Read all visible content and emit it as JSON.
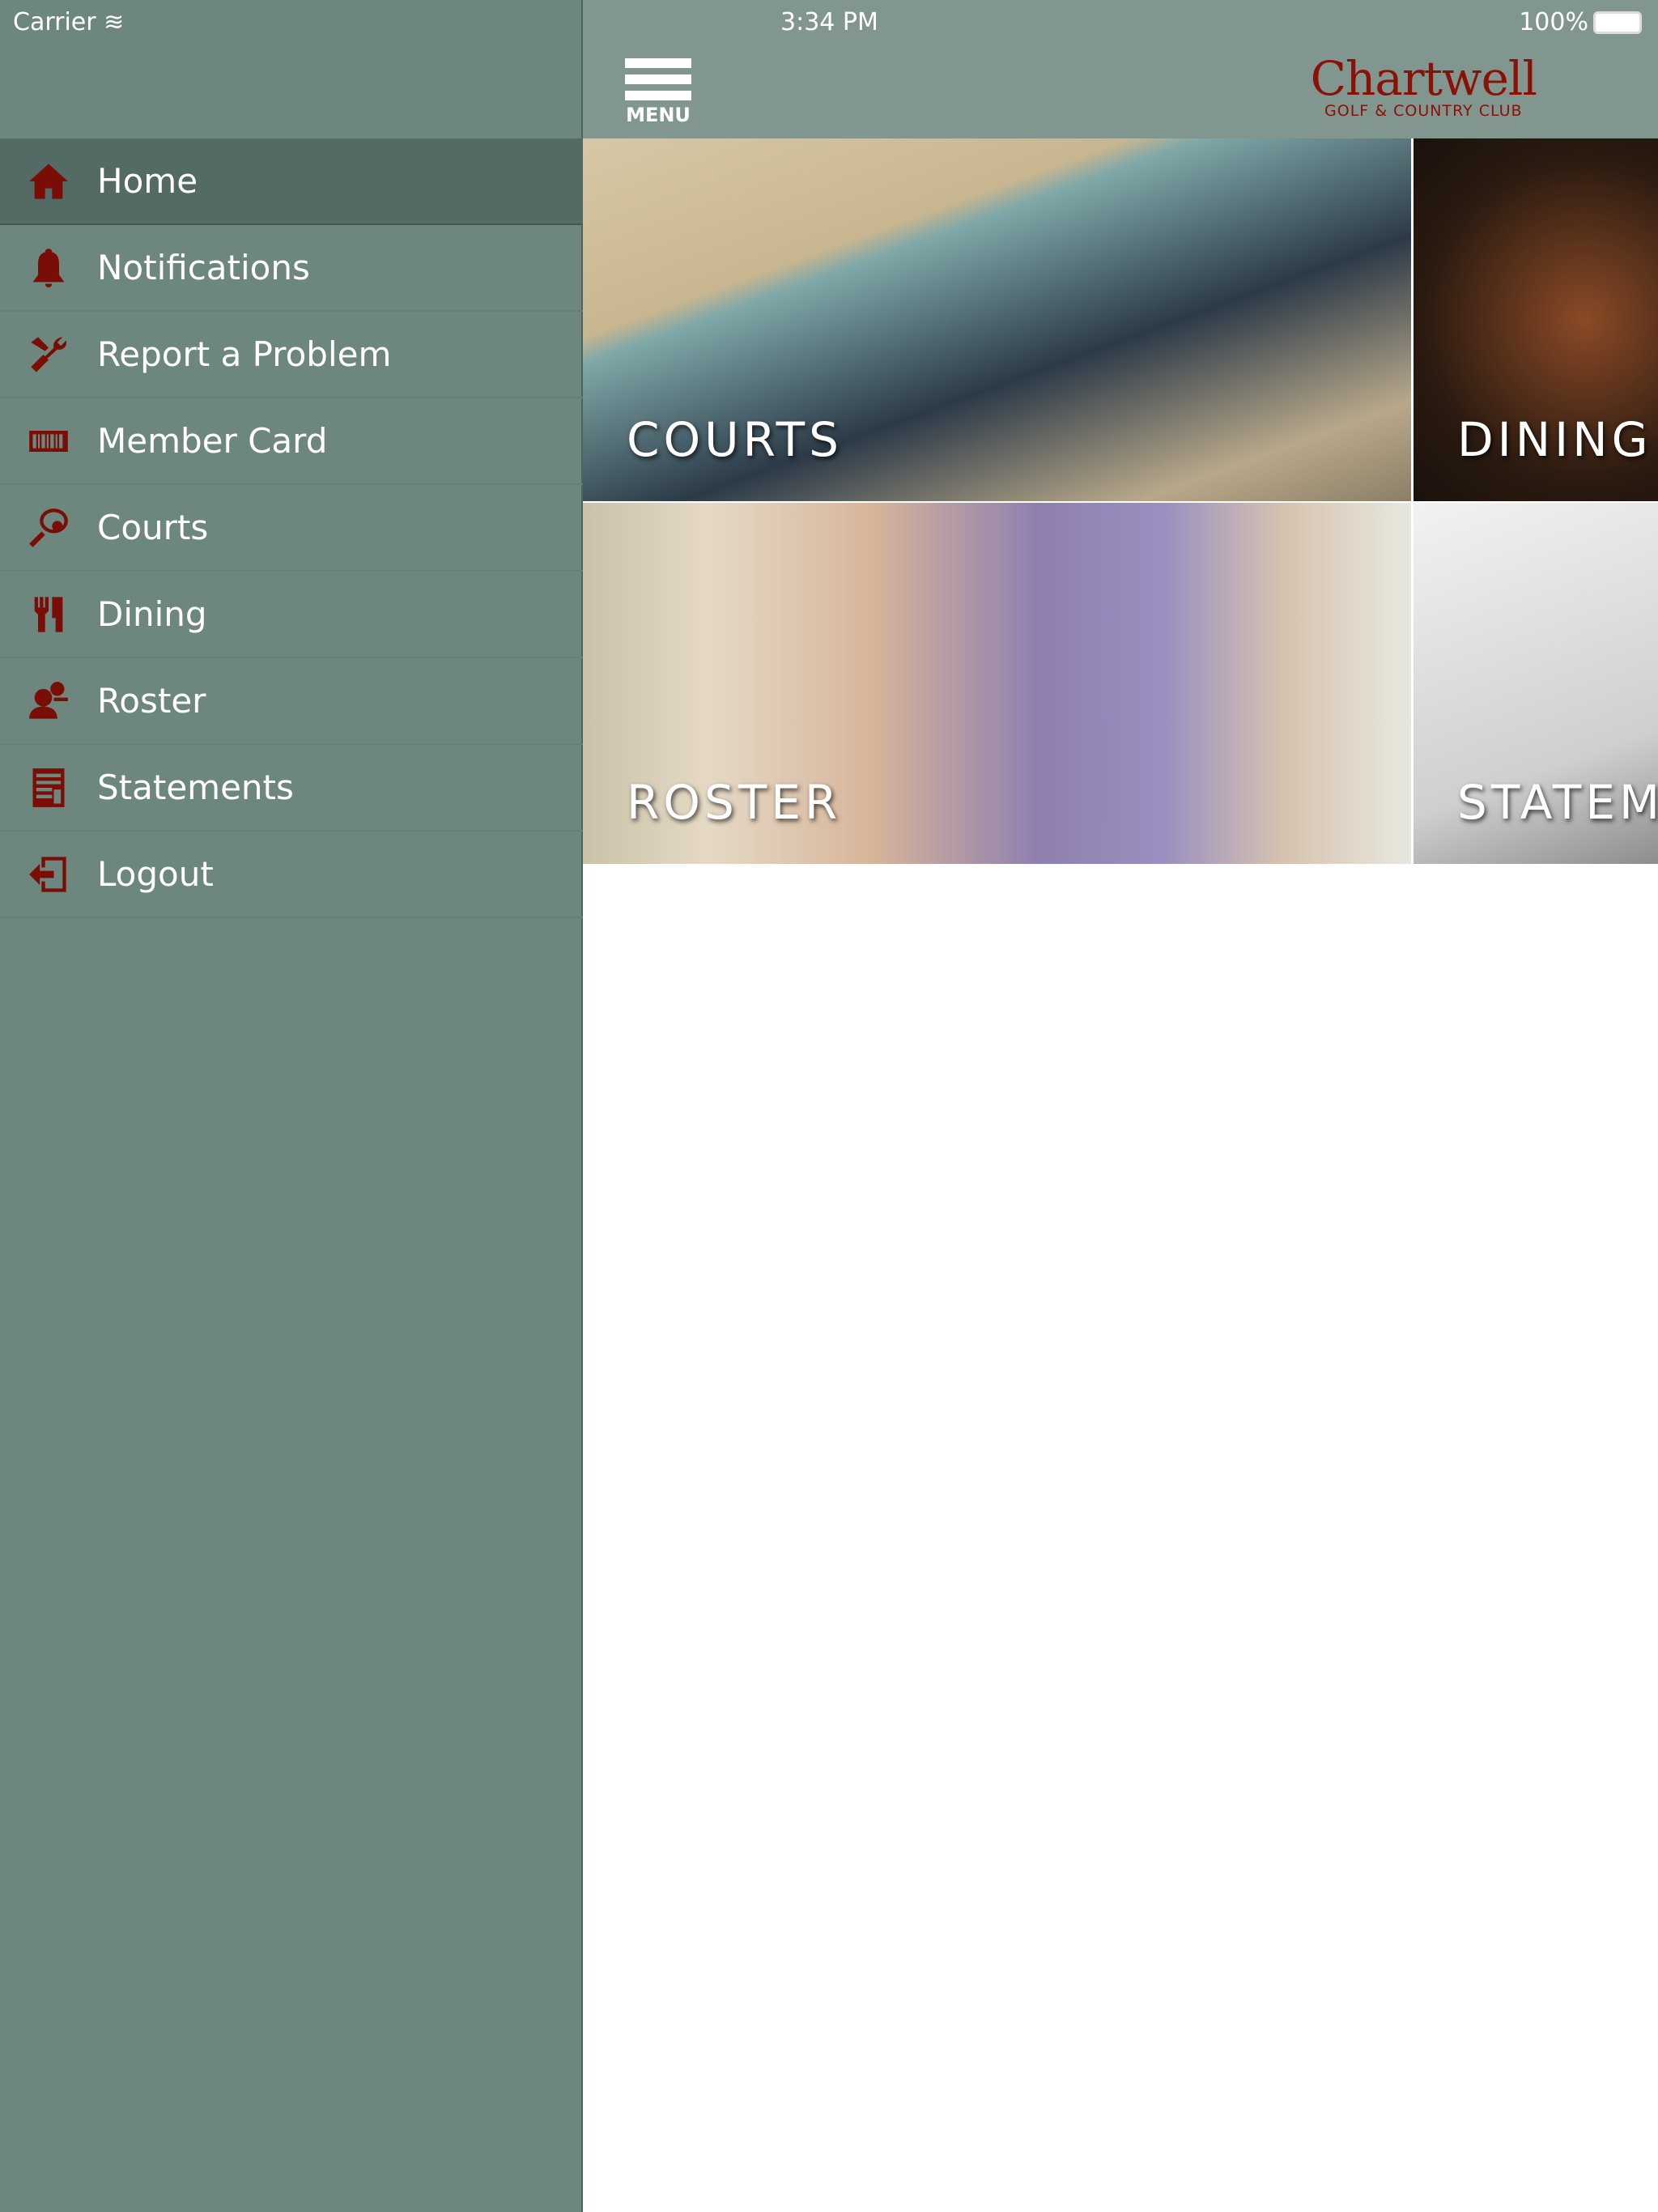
{
  "status_bar": {
    "carrier": "Carrier",
    "time": "3:34 PM",
    "battery": "100%"
  },
  "header": {
    "menu_label": "MENU",
    "logo_name": "Chartwell",
    "logo_sub": "GOLF & COUNTRY CLUB"
  },
  "sidebar": {
    "items": [
      {
        "label": "Home",
        "icon": "home-icon",
        "selected": true
      },
      {
        "label": "Notifications",
        "icon": "bell-icon"
      },
      {
        "label": "Report a Problem",
        "icon": "tools-icon"
      },
      {
        "label": "Member Card",
        "icon": "barcode-card-icon"
      },
      {
        "label": "Courts",
        "icon": "tennis-racket-icon"
      },
      {
        "label": "Dining",
        "icon": "fork-knife-icon"
      },
      {
        "label": "Roster",
        "icon": "people-icon"
      },
      {
        "label": "Statements",
        "icon": "statement-icon"
      },
      {
        "label": "Logout",
        "icon": "logout-icon"
      }
    ]
  },
  "tiles": [
    {
      "label": "COURTS"
    },
    {
      "label": "DINING"
    },
    {
      "label": "ROSTER"
    },
    {
      "label": "STATEM"
    }
  ],
  "colors": {
    "sidebar": "#6d877f",
    "header": "#81968f",
    "selected": "#536b64",
    "icon": "#7a0d06"
  }
}
